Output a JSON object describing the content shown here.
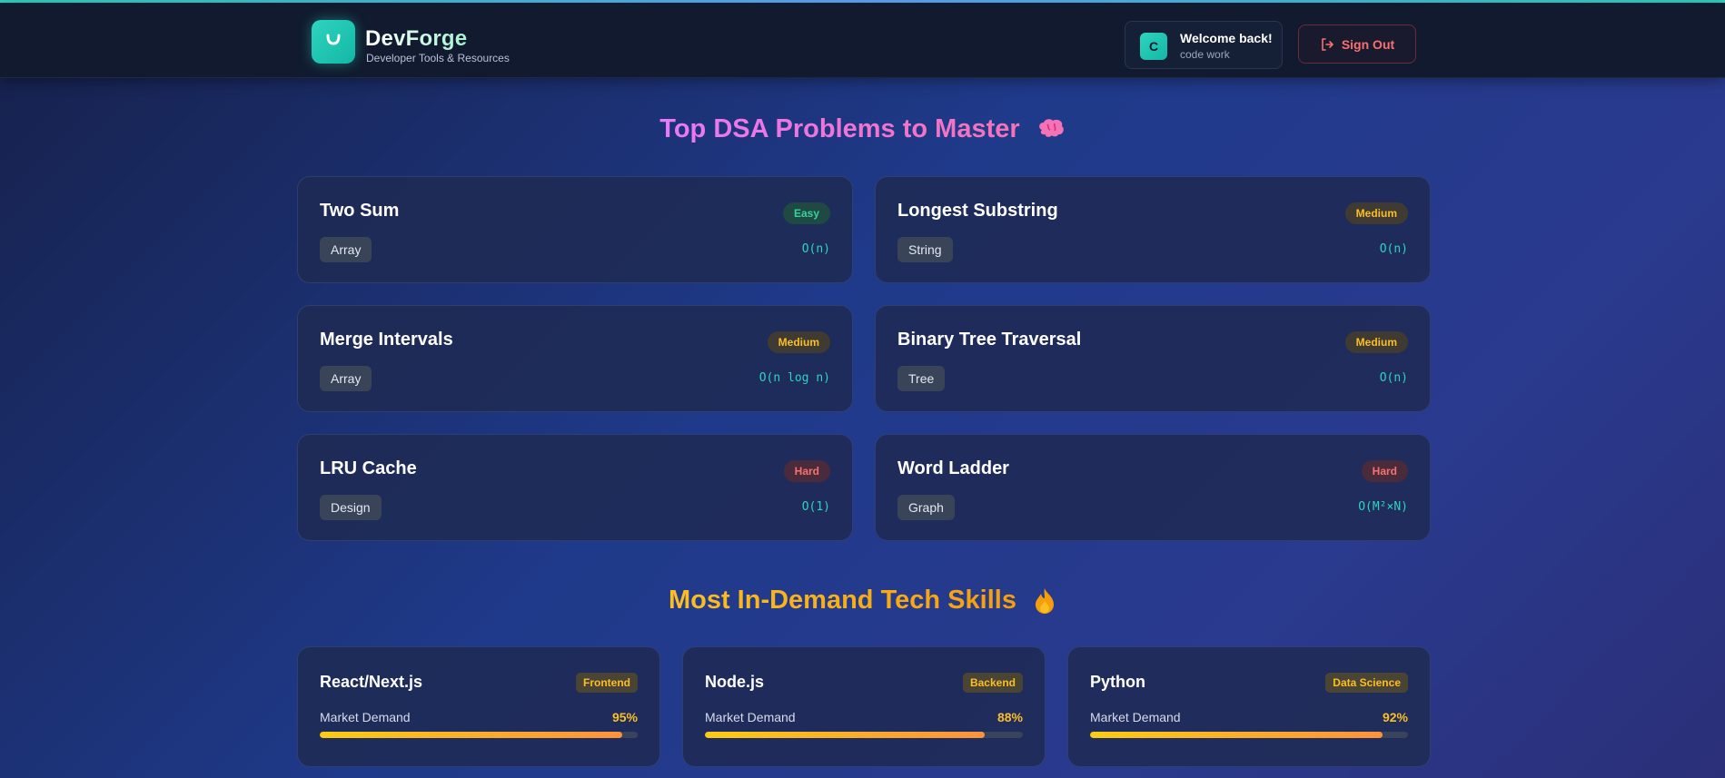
{
  "header": {
    "brand_name": "DevForge",
    "brand_subtitle": "Developer Tools & Resources",
    "avatar_initial": "C",
    "welcome": "Welcome back!",
    "username": "code work",
    "signout_label": "Sign Out"
  },
  "dsa": {
    "title": "Top DSA Problems to Master",
    "problems": [
      {
        "title": "Two Sum",
        "difficulty": "Easy",
        "tag": "Array",
        "complexity": "O(n)"
      },
      {
        "title": "Longest Substring",
        "difficulty": "Medium",
        "tag": "String",
        "complexity": "O(n)"
      },
      {
        "title": "Merge Intervals",
        "difficulty": "Medium",
        "tag": "Array",
        "complexity": "O(n log n)"
      },
      {
        "title": "Binary Tree Traversal",
        "difficulty": "Medium",
        "tag": "Tree",
        "complexity": "O(n)"
      },
      {
        "title": "LRU Cache",
        "difficulty": "Hard",
        "tag": "Design",
        "complexity": "O(1)"
      },
      {
        "title": "Word Ladder",
        "difficulty": "Hard",
        "tag": "Graph",
        "complexity": "O(M²×N)"
      }
    ]
  },
  "skills": {
    "title": "Most In-Demand Tech Skills",
    "items": [
      {
        "title": "React/Next.js",
        "category": "Frontend",
        "label": "Market Demand",
        "demand": "95%",
        "demand_value": 95
      },
      {
        "title": "Node.js",
        "category": "Backend",
        "label": "Market Demand",
        "demand": "88%",
        "demand_value": 88
      },
      {
        "title": "Python",
        "category": "Data Science",
        "label": "Market Demand",
        "demand": "92%",
        "demand_value": 92
      }
    ]
  },
  "colors": {
    "accent_teal": "#2dd4bf",
    "easy": "#34d399",
    "medium": "#fbbf24",
    "hard": "#f87171",
    "dsa_title": "#e879f9",
    "skills_title": "#fbbf24"
  },
  "icons": {
    "logo": "smile-icon",
    "signout": "sign-out-icon",
    "dsa_title": "brain-icon",
    "skills_title": "fire-icon"
  }
}
